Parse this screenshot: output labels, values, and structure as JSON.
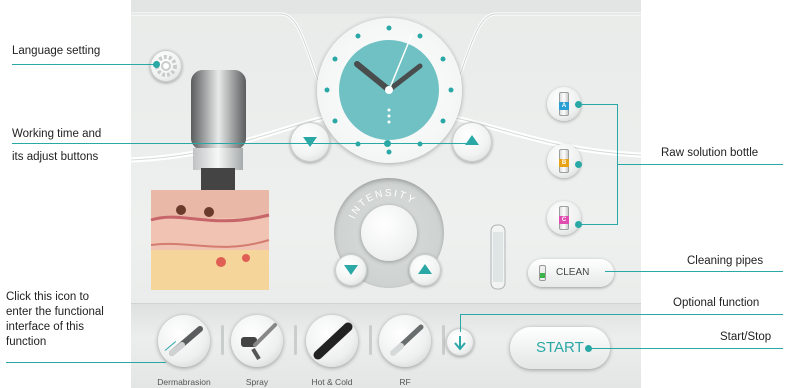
{
  "annotations": {
    "language": "Language setting",
    "working_time_line1": "Working time and",
    "working_time_line2": "its adjust buttons",
    "raw_solution": "Raw solution bottle",
    "cleaning": "Cleaning pipes",
    "optional": "Optional function",
    "start_stop": "Start/Stop",
    "click_icon_line1": "Click this icon to",
    "click_icon_line2": "enter the functional",
    "click_icon_line3": "interface of this",
    "click_icon_line4": "function"
  },
  "intensity_label": "INTENSITY",
  "bottles": [
    {
      "tag": "A",
      "color": "#2a9fd6"
    },
    {
      "tag": "B",
      "color": "#e8a317"
    },
    {
      "tag": "C",
      "color": "#e04db0"
    }
  ],
  "clean_label": "CLEAN",
  "start_label": "START",
  "tools": [
    {
      "label": "Dermabrasion"
    },
    {
      "label": "Spray"
    },
    {
      "label": "Hot & Cold"
    },
    {
      "label": "RF"
    }
  ],
  "colors": {
    "accent": "#2aa8a6",
    "clock_face": "#6fc1c3"
  }
}
